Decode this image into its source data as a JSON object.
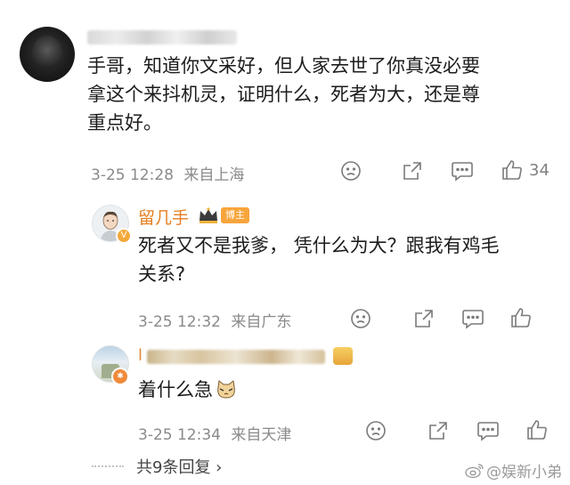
{
  "comment": {
    "text": "手哥，知道你文采好，但人家去世了你真没必要拿这个来抖机灵，证明什么，死者为大，还是尊重点好。",
    "lines": [
      "手哥，知道你文采好，但人家去世了你真没必要",
      "拿这个来抖机灵，证明什么，死者为大，还是尊",
      "重点好。"
    ],
    "time": "3-25 12:28",
    "location": "来自上海",
    "likes": "34"
  },
  "replies": [
    {
      "name": "留几手",
      "badge": "博主",
      "lines": [
        "死者又不是我爹， 凭什么为大？跟我有鸡毛",
        "关系?"
      ],
      "time": "3-25 12:32",
      "location": "来自广东"
    },
    {
      "name_prefix": "l",
      "lines": [
        "着什么急"
      ],
      "time": "3-25 12:34",
      "location": "来自天津"
    }
  ],
  "more_replies": "共9条回复 ›",
  "watermark": "@娱新小弟",
  "colors": {
    "accent_orange": "#f7a43b",
    "meta_gray": "#8a8a8a"
  },
  "icons": [
    "dislike-icon",
    "share-icon",
    "comment-icon",
    "like-icon",
    "crown-icon",
    "cat-emoji-icon",
    "weibo-logo-icon"
  ]
}
